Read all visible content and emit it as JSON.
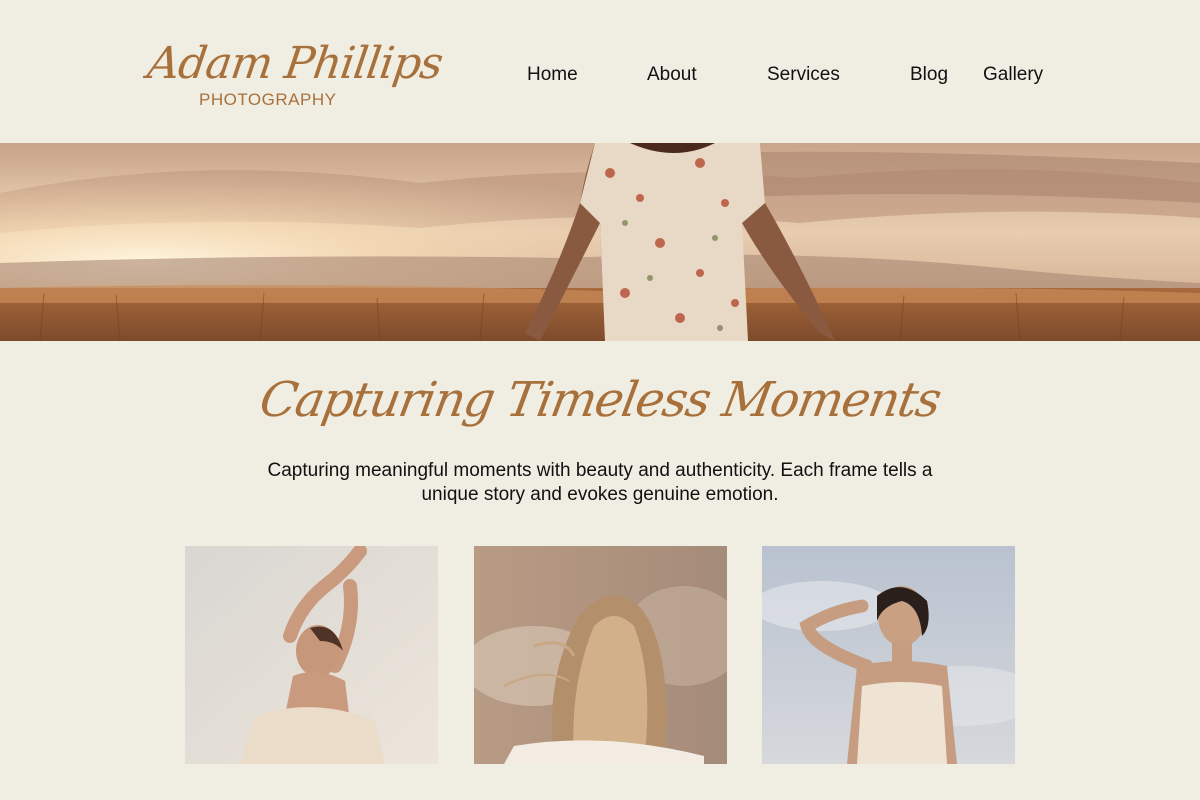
{
  "brand": {
    "name": "Adam Phillips",
    "tagline": "PHOTOGRAPHY",
    "accent_color": "#a8713c",
    "background_color": "#f0ede2"
  },
  "nav": {
    "items": [
      {
        "label": "Home"
      },
      {
        "label": "About"
      },
      {
        "label": "Services"
      },
      {
        "label": "Blog"
      },
      {
        "label": "Gallery"
      }
    ]
  },
  "hero": {
    "image": "woman-in-floral-dress-in-wheat-field-at-sunset"
  },
  "main": {
    "headline": "Capturing Timeless Moments",
    "intro": "Capturing meaningful moments with beauty and authenticity. Each frame tells a unique story and evokes genuine emotion."
  },
  "gallery": {
    "photos": [
      {
        "image": "woman-arms-raised-against-sky"
      },
      {
        "image": "woman-blonde-hair-windblown-from-behind"
      },
      {
        "image": "woman-shading-eyes-in-sunlight"
      }
    ]
  }
}
